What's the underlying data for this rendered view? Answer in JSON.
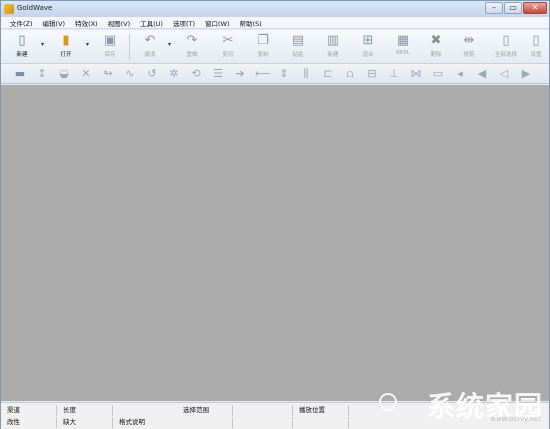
{
  "window": {
    "title": "GoldWave"
  },
  "menu": [
    {
      "label": "文件(Z)"
    },
    {
      "label": "编辑(V)"
    },
    {
      "label": "特效(X)"
    },
    {
      "label": "视图(V)"
    },
    {
      "label": "工具(U)"
    },
    {
      "label": "选项(T)"
    },
    {
      "label": "窗口(W)"
    },
    {
      "label": "帮助(S)"
    }
  ],
  "toolbar": {
    "buttons": [
      {
        "label": "新建",
        "icon": "new-file-icon",
        "glyph": "▯"
      },
      {
        "label": "打开",
        "icon": "open-folder-icon",
        "glyph": "▮"
      },
      {
        "label": "保存",
        "icon": "save-icon",
        "glyph": "▣"
      },
      {
        "label": "撤消",
        "icon": "undo-icon",
        "glyph": "↶"
      },
      {
        "label": "重做",
        "icon": "redo-icon",
        "glyph": "↷"
      },
      {
        "label": "剪切",
        "icon": "cut-icon",
        "glyph": "✂"
      },
      {
        "label": "复制",
        "icon": "copy-icon",
        "glyph": "❐"
      },
      {
        "label": "粘贴",
        "icon": "paste-icon",
        "glyph": "▤"
      },
      {
        "label": "新建",
        "icon": "paste-new-icon",
        "glyph": "▥"
      },
      {
        "label": "混合",
        "icon": "mix-icon",
        "glyph": "⊞"
      },
      {
        "label": "REPL",
        "icon": "replace-icon",
        "glyph": "▦"
      },
      {
        "label": "删除",
        "icon": "delete-icon",
        "glyph": "✖"
      },
      {
        "label": "修剪",
        "icon": "trim-icon",
        "glyph": "⇹"
      },
      {
        "label": "全部选择",
        "icon": "select-all-icon",
        "glyph": "▯"
      },
      {
        "label": "设置",
        "icon": "settings-icon",
        "glyph": "▯"
      }
    ]
  },
  "effects_toolbar": {
    "icons": [
      "waveform-icon",
      "stretch-icon",
      "doppler-icon",
      "mute-icon",
      "fade-icon",
      "curve-icon",
      "echo-icon",
      "gear-icon",
      "filter-icon",
      "equalizer-icon",
      "forward-icon",
      "back-icon",
      "pitch-icon",
      "bars-icon",
      "mechanize-icon",
      "reverb-icon",
      "offset-icon",
      "invert-icon",
      "compress-icon",
      "noise-icon",
      "volume-icon",
      "speaker-left-icon",
      "speaker-icon",
      "speaker-right-icon"
    ]
  },
  "status": {
    "row1": [
      "渠道",
      "长度",
      "选择范围",
      "",
      "播放位置",
      ""
    ],
    "row2": [
      "改性",
      "缺大",
      "格式说明",
      "",
      "",
      ""
    ]
  },
  "watermark": {
    "text": "系统家园",
    "sub": "www.bonly.net"
  }
}
